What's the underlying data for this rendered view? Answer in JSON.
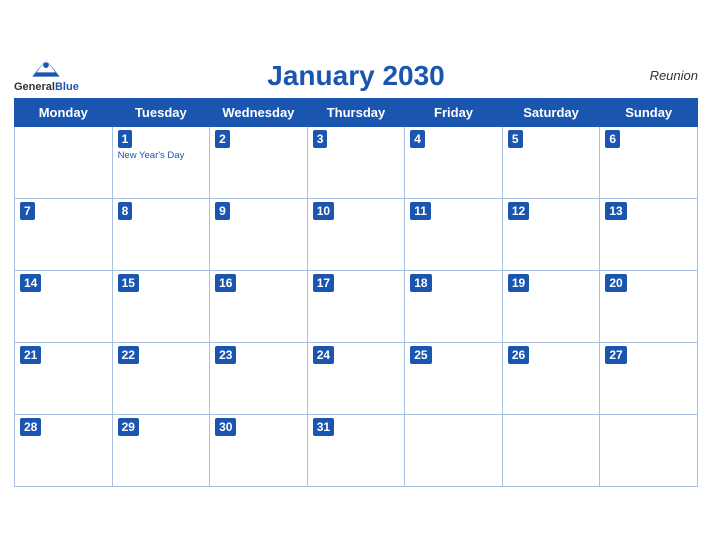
{
  "header": {
    "title": "January 2030",
    "region": "Reunion",
    "logo_line1": "General",
    "logo_line2": "Blue"
  },
  "weekdays": [
    "Monday",
    "Tuesday",
    "Wednesday",
    "Thursday",
    "Friday",
    "Saturday",
    "Sunday"
  ],
  "weeks": [
    [
      {
        "day": null
      },
      {
        "day": 1,
        "holiday": "New Year's Day"
      },
      {
        "day": 2
      },
      {
        "day": 3
      },
      {
        "day": 4
      },
      {
        "day": 5
      },
      {
        "day": 6
      }
    ],
    [
      {
        "day": 7
      },
      {
        "day": 8
      },
      {
        "day": 9
      },
      {
        "day": 10
      },
      {
        "day": 11
      },
      {
        "day": 12
      },
      {
        "day": 13
      }
    ],
    [
      {
        "day": 14
      },
      {
        "day": 15
      },
      {
        "day": 16
      },
      {
        "day": 17
      },
      {
        "day": 18
      },
      {
        "day": 19
      },
      {
        "day": 20
      }
    ],
    [
      {
        "day": 21
      },
      {
        "day": 22
      },
      {
        "day": 23
      },
      {
        "day": 24
      },
      {
        "day": 25
      },
      {
        "day": 26
      },
      {
        "day": 27
      }
    ],
    [
      {
        "day": 28
      },
      {
        "day": 29
      },
      {
        "day": 30
      },
      {
        "day": 31
      },
      {
        "day": null
      },
      {
        "day": null
      },
      {
        "day": null
      }
    ]
  ],
  "colors": {
    "header_bg": "#1a56b0",
    "accent": "#1a56b0"
  }
}
